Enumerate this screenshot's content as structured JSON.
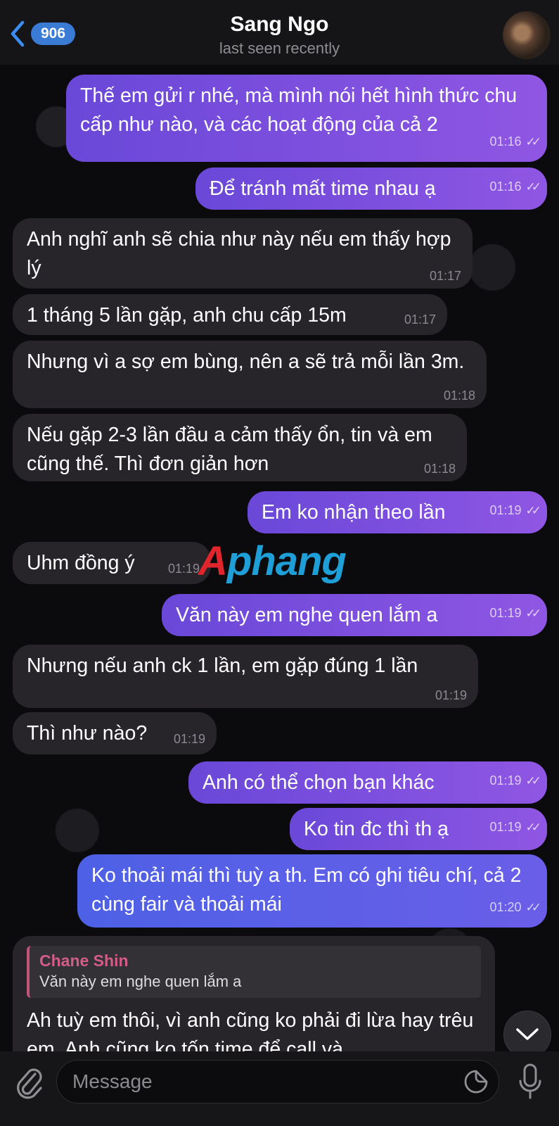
{
  "header": {
    "back_badge": "906",
    "contact_name": "Sang Ngo",
    "status": "last seen recently"
  },
  "messages": [
    {
      "dir": "out",
      "text": "Thế em gửi r nhé, mà mình nói hết hình thức chu cấp như nào, và các hoạt động của cả 2",
      "time": "01:16"
    },
    {
      "dir": "out",
      "text": "Để tránh mất time nhau ạ",
      "time": "01:16"
    },
    {
      "dir": "in",
      "text": "Anh nghĩ anh sẽ chia như này nếu em thấy hợp lý",
      "time": "01:17"
    },
    {
      "dir": "in",
      "text": "1 tháng 5 lần gặp, anh chu cấp 15m",
      "time": "01:17"
    },
    {
      "dir": "in",
      "text": "Nhưng vì a sợ em bùng, nên a sẽ trả mỗi lần 3m.",
      "time": "01:18"
    },
    {
      "dir": "in",
      "text": "Nếu gặp 2-3 lần đầu a cảm thấy ổn, tin và em cũng thế. Thì đơn giản hơn",
      "time": "01:18"
    },
    {
      "dir": "out",
      "text": "Em ko nhận theo lần",
      "time": "01:19"
    },
    {
      "dir": "in",
      "text": "Uhm đồng ý",
      "time": "01:19"
    },
    {
      "dir": "out",
      "text": "Văn này em nghe quen lắm a",
      "time": "01:19"
    },
    {
      "dir": "in",
      "text": "Nhưng nếu anh ck 1 lần, em gặp đúng 1 lần",
      "time": "01:19"
    },
    {
      "dir": "in",
      "text": "Thì như nào?",
      "time": "01:19"
    },
    {
      "dir": "out",
      "text": "Anh có thể chọn bạn khác",
      "time": "01:19"
    },
    {
      "dir": "out",
      "text": "Ko tin đc thì th ạ",
      "time": "01:19"
    },
    {
      "dir": "out",
      "text": "Ko thoải mái thì tuỳ a th. Em có ghi tiêu chí, cả 2 cùng fair và thoải mái",
      "time": "01:20"
    },
    {
      "dir": "in",
      "reply_author": "Chane Shin",
      "reply_text": "Văn này em nghe quen lắm a",
      "text": "Ah tuỳ em thôi, vì anh cũng ko phải đi lừa hay trêu em. Anh cũng ko tốn time để call và"
    }
  ],
  "watermark": {
    "lead": "A",
    "rest": "phang"
  },
  "input": {
    "placeholder": "Message"
  },
  "icons": {
    "back": "chevron-left-icon",
    "attach": "paperclip-icon",
    "sticker": "sticker-icon",
    "mic": "microphone-icon",
    "scroll": "chevron-down-icon"
  },
  "colors": {
    "outgoing": "#7a4fdf",
    "incoming": "#27242a",
    "accent": "#3a7bd5",
    "reply_author": "#d45d86"
  }
}
